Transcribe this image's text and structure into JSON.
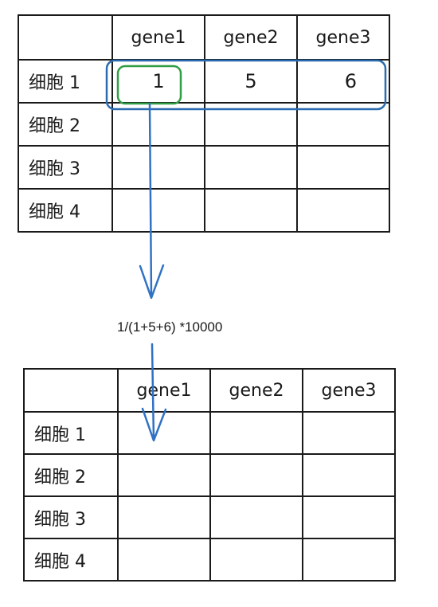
{
  "top_table": {
    "columns": [
      "gene1",
      "gene2",
      "gene3"
    ],
    "rows": [
      {
        "label": "细胞 1",
        "values": [
          "1",
          "5",
          "6"
        ]
      },
      {
        "label": "细胞 2",
        "values": [
          "",
          "",
          ""
        ]
      },
      {
        "label": "细胞 3",
        "values": [
          "",
          "",
          ""
        ]
      },
      {
        "label": "细胞 4",
        "values": [
          "",
          "",
          ""
        ]
      }
    ]
  },
  "formula": "1/(1+5+6) *10000",
  "bottom_table": {
    "columns": [
      "gene1",
      "gene2",
      "gene3"
    ],
    "rows": [
      {
        "label": "细胞 1",
        "values": [
          "",
          "",
          ""
        ]
      },
      {
        "label": "细胞 2",
        "values": [
          "",
          "",
          ""
        ]
      },
      {
        "label": "细胞 3",
        "values": [
          "",
          "",
          ""
        ]
      },
      {
        "label": "细胞 4",
        "values": [
          "",
          "",
          ""
        ]
      }
    ]
  },
  "colors": {
    "row_highlight": "#2b6cb0",
    "cell_highlight": "#2f9e44",
    "arrow": "#2f72c4",
    "grid": "#1a1a1a"
  }
}
